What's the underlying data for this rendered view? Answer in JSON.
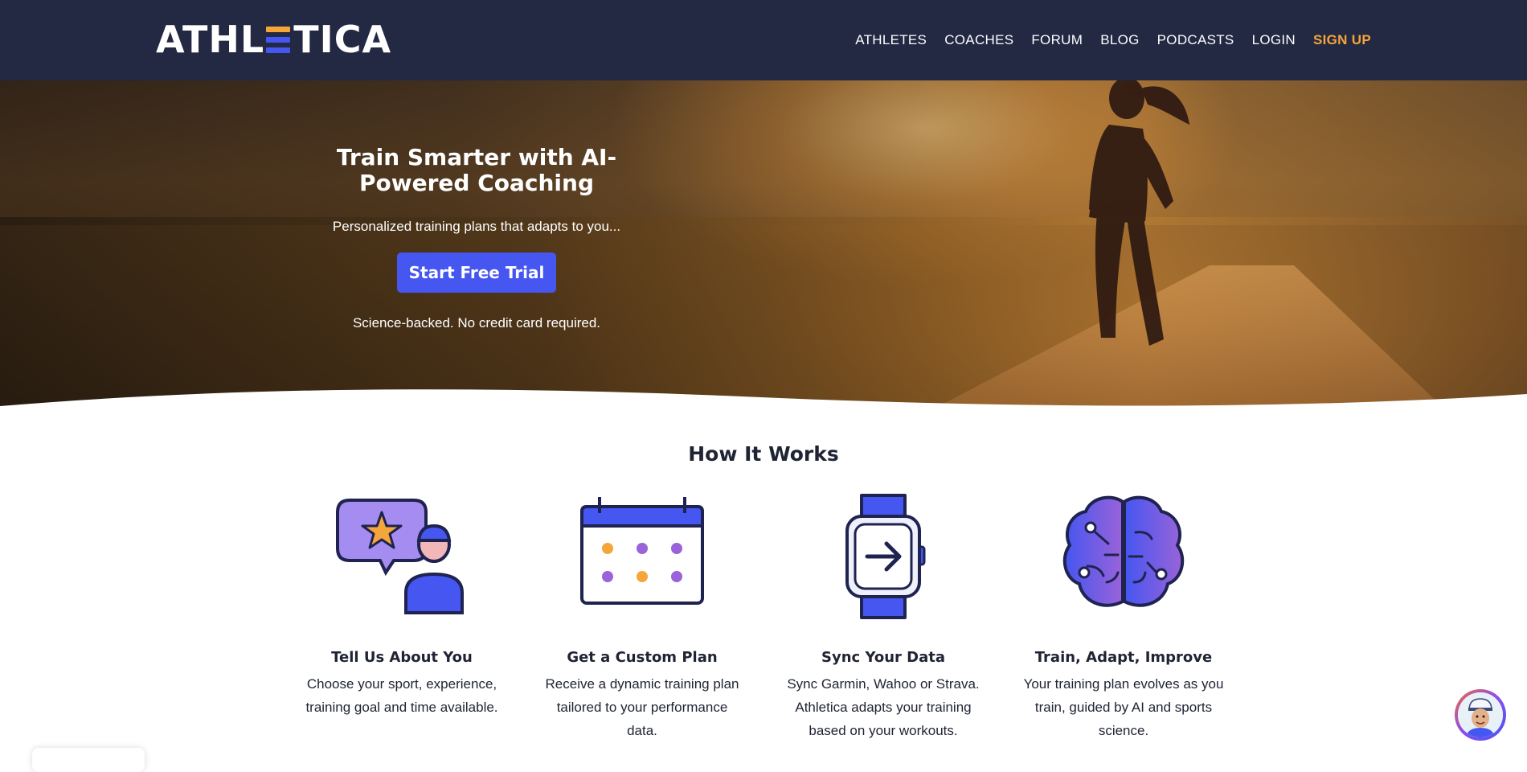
{
  "brand": {
    "logo_left": "ATHL",
    "logo_right": "TICA",
    "accent_orange": "#f4a63a",
    "accent_blue": "#4556f1",
    "header_bg": "#232843"
  },
  "nav": {
    "items": [
      "ATHLETES",
      "COACHES",
      "FORUM",
      "BLOG",
      "PODCASTS",
      "LOGIN"
    ],
    "signup": "SIGN UP"
  },
  "hero": {
    "title": "Train Smarter with AI-Powered Coaching",
    "subtitle": "Personalized training plans that adapts to you...",
    "cta_label": "Start Free Trial",
    "note": "Science-backed. No credit card required."
  },
  "how_it_works": {
    "title": "How It Works",
    "steps": [
      {
        "icon": "chat-profile-icon",
        "title": "Tell Us About You",
        "desc": "Choose your sport, experience, training goal and time available."
      },
      {
        "icon": "calendar-icon",
        "title": "Get a Custom Plan",
        "desc": "Receive a dynamic training plan tailored to your performance data."
      },
      {
        "icon": "smartwatch-icon",
        "title": "Sync Your Data",
        "desc": "Sync Garmin, Wahoo or Strava. Athletica adapts your training based on your workouts."
      },
      {
        "icon": "brain-icon",
        "title": "Train, Adapt, Improve",
        "desc": "Your training plan evolves as you train, guided by AI and sports science."
      }
    ]
  },
  "chat_widget": {
    "icon": "coach-avatar-icon"
  }
}
